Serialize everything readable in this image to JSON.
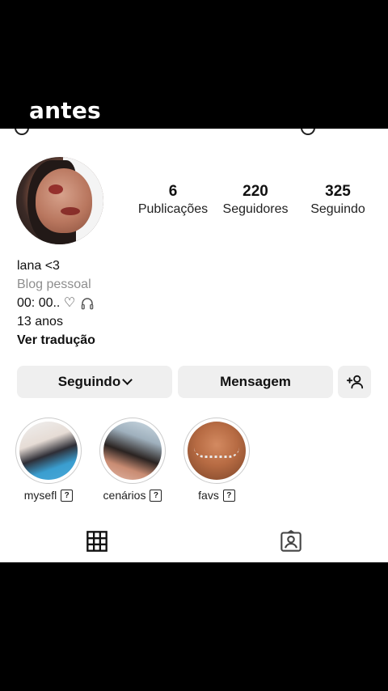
{
  "caption": "antes",
  "profile": {
    "stats": {
      "posts": {
        "value": "6",
        "label": "Publicações"
      },
      "followers": {
        "value": "220",
        "label": "Seguidores"
      },
      "following": {
        "value": "325",
        "label": "Seguindo"
      }
    },
    "name": "lana <3",
    "category": "Blog pessoal",
    "bio_line": "00: 00.. ♡",
    "age": "13 anos",
    "translate": "Ver tradução"
  },
  "buttons": {
    "follow": "Seguindo",
    "message": "Mensagem",
    "add_person_icon": "add-person-icon"
  },
  "highlights": [
    {
      "label": "mysefl",
      "badge": "?"
    },
    {
      "label": "cenários",
      "badge": "?"
    },
    {
      "label": "favs",
      "badge": "?"
    }
  ],
  "tabs": {
    "grid_icon": "grid-icon",
    "tagged_icon": "tagged-person-icon"
  },
  "colors": {
    "button_bg": "#efefef",
    "muted_text": "#8e8e8e",
    "background": "#ffffff",
    "letterbox": "#000000"
  }
}
